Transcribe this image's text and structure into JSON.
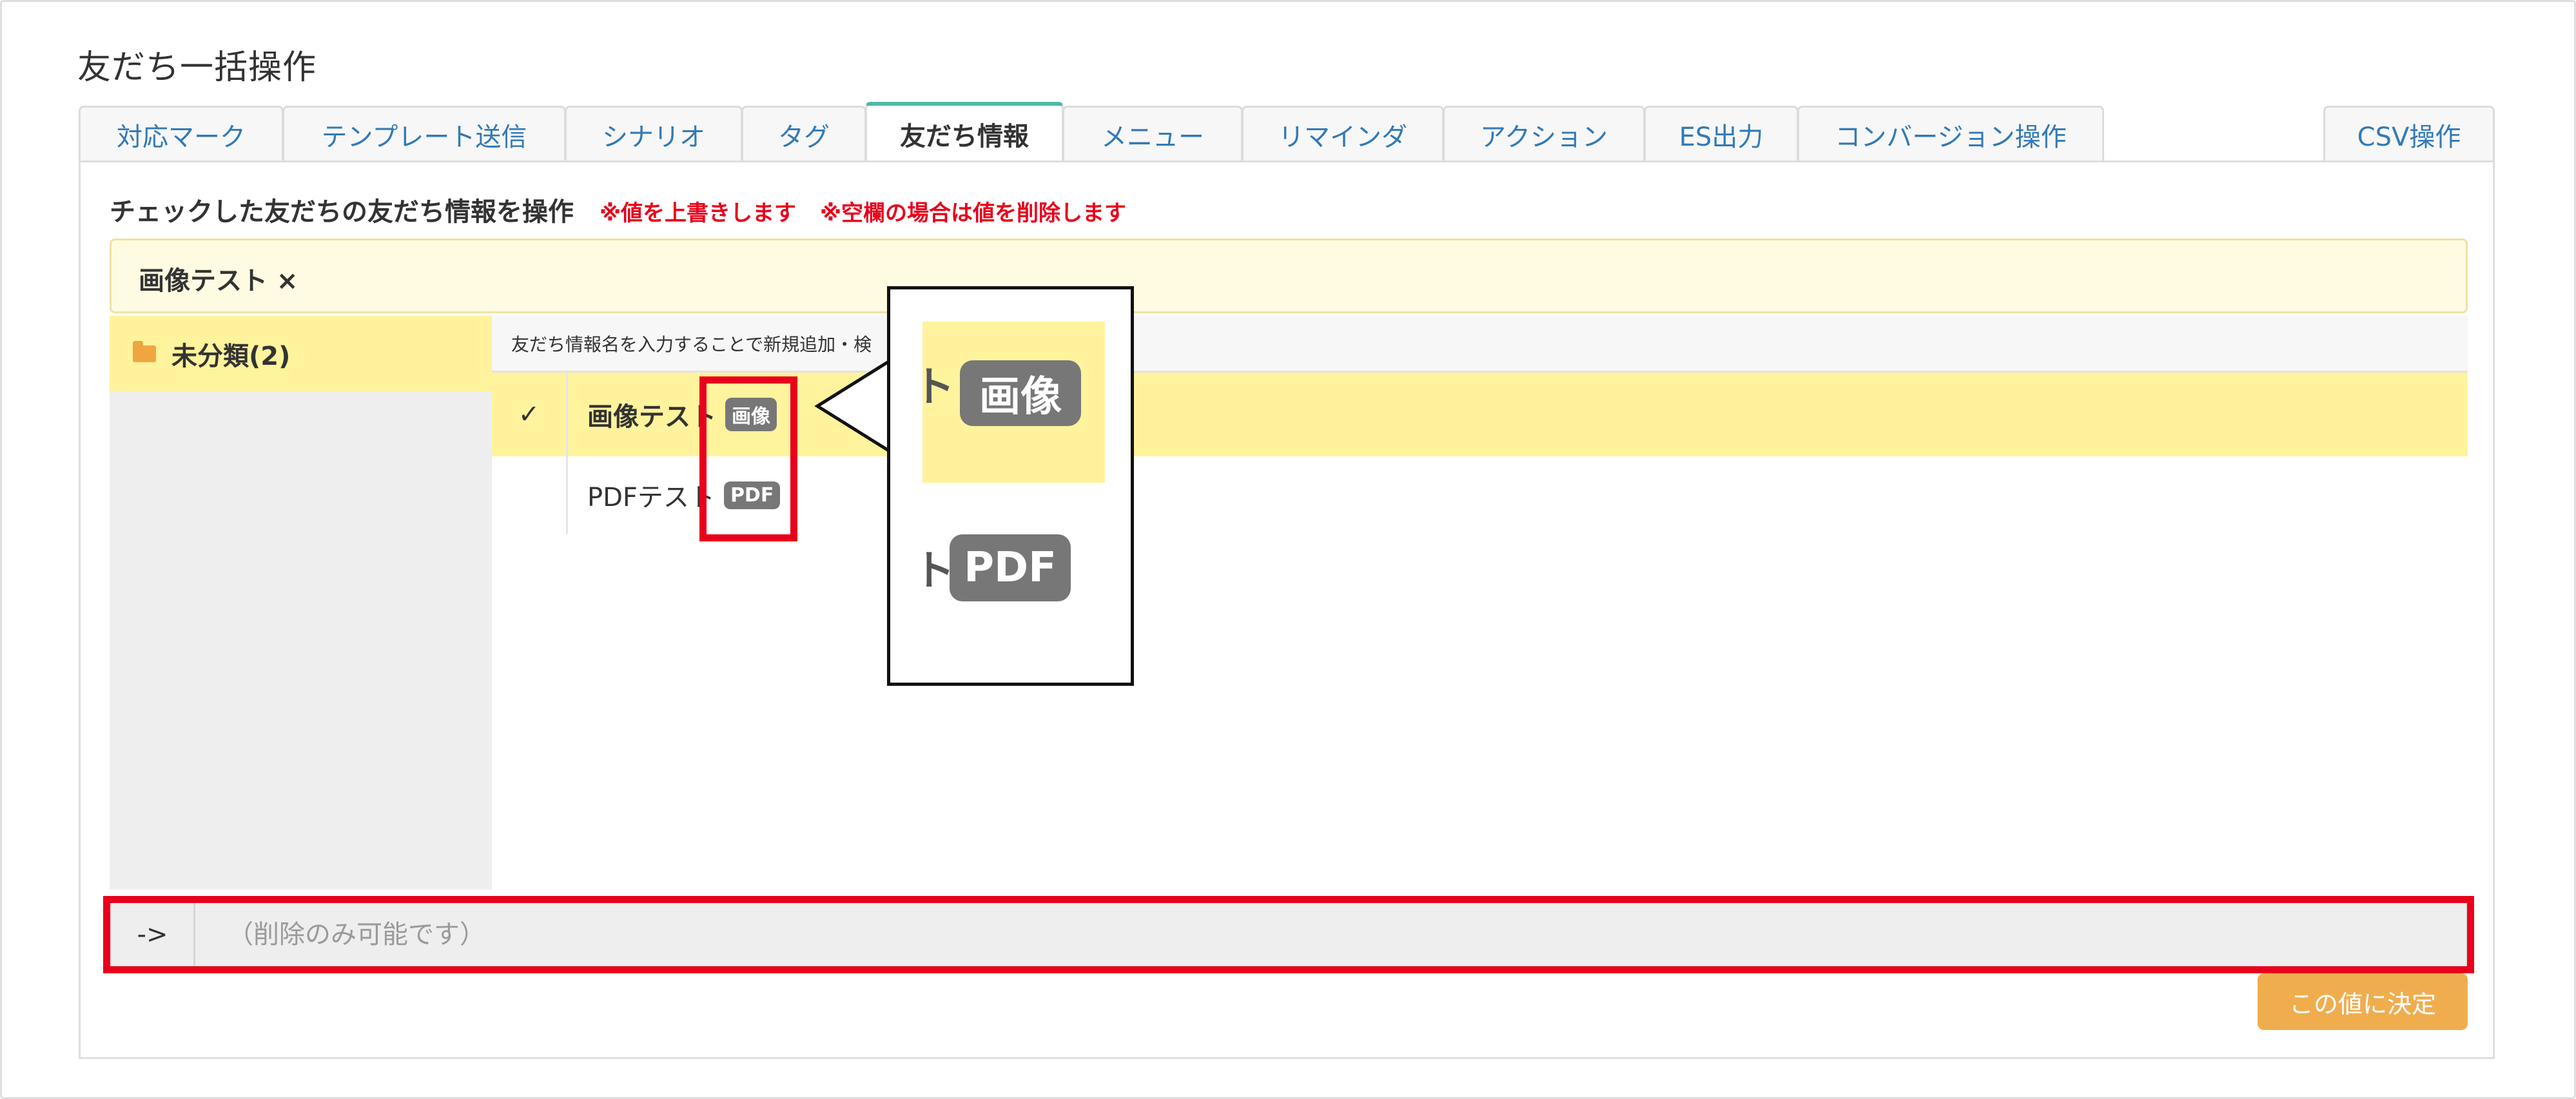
{
  "page": {
    "title": "友だち一括操作"
  },
  "tabs": [
    {
      "label": "対応マーク",
      "active": false
    },
    {
      "label": "テンプレート送信",
      "active": false
    },
    {
      "label": "シナリオ",
      "active": false
    },
    {
      "label": "タグ",
      "active": false
    },
    {
      "label": "友だち情報",
      "active": true
    },
    {
      "label": "メニュー",
      "active": false
    },
    {
      "label": "リマインダ",
      "active": false
    },
    {
      "label": "アクション",
      "active": false
    },
    {
      "label": "ES出力",
      "active": false
    },
    {
      "label": "コンバージョン操作",
      "active": false
    },
    {
      "label": "CSV操作",
      "active": false
    }
  ],
  "instruction": {
    "text": "チェックした友だちの友だち情報を操作",
    "warning_overwrite": "※値を上書きします",
    "warning_delete": "※空欄の場合は値を削除します"
  },
  "selected": {
    "tag": "画像テスト ×"
  },
  "folders": [
    {
      "label": "未分類(2)",
      "icon": "folder-open-icon"
    }
  ],
  "search": {
    "text": "友だち情報名を入力することで新規追加・検"
  },
  "items": [
    {
      "check": "✓",
      "label": "画像テスト",
      "badge": "画像",
      "selected": true
    },
    {
      "check": "",
      "label": "PDFテスト",
      "badge": "PDF",
      "selected": false
    }
  ],
  "callout": {
    "zoom_image_text": "ト",
    "zoom_image_badge": "画像",
    "zoom_pdf_text": "ト",
    "zoom_pdf_badge": "PDF"
  },
  "value_input": {
    "arrow": "->",
    "placeholder": "（削除のみ可能です）"
  },
  "confirm_button": {
    "label": "この値に決定"
  },
  "colors": {
    "accent_red": "#e8001c",
    "highlight_yellow": "#fff39d",
    "button_orange": "#f0ad4e",
    "link_blue": "#337ab7",
    "active_tab_border": "#4fb8a8"
  }
}
